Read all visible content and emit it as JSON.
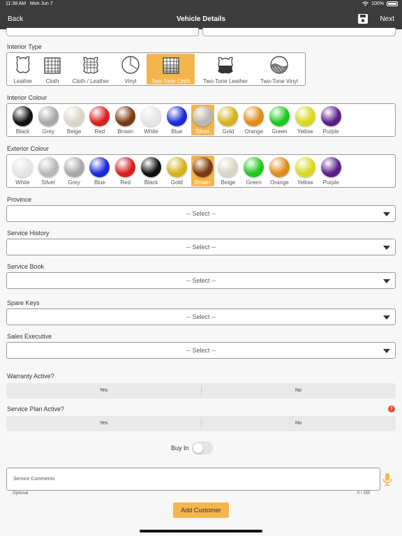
{
  "status": {
    "time": "11:38 AM",
    "date": "Mon Jun 7",
    "battery": "100%"
  },
  "nav": {
    "back": "Back",
    "title": "Vehicle Details",
    "next": "Next"
  },
  "interior_type": {
    "label": "Interior Type",
    "options": [
      "Leather",
      "Cloth",
      "Cloth / Leather",
      "Vinyl",
      "Two-Tone Cloth",
      "Two-Tone Leather",
      "Two-Tone Vinyl"
    ],
    "selected": "Two-Tone Cloth"
  },
  "interior_colour": {
    "label": "Interior Colour",
    "options": [
      {
        "name": "Black",
        "color": "#111111"
      },
      {
        "name": "Grey",
        "color": "#a8a8a8"
      },
      {
        "name": "Beige",
        "color": "#d8d6c8"
      },
      {
        "name": "Red",
        "color": "#d81f1f"
      },
      {
        "name": "Brown",
        "color": "#7a3a12"
      },
      {
        "name": "White",
        "color": "#e4e4e4"
      },
      {
        "name": "Blue",
        "color": "#1a2ad8"
      },
      {
        "name": "Silver",
        "color": "#b8b8b8"
      },
      {
        "name": "Gold",
        "color": "#d4b21a"
      },
      {
        "name": "Orange",
        "color": "#e08a1a"
      },
      {
        "name": "Green",
        "color": "#1ec81e"
      },
      {
        "name": "Yellow",
        "color": "#d8d820"
      },
      {
        "name": "Purple",
        "color": "#5a1f8a"
      }
    ],
    "selected": "Silver"
  },
  "exterior_colour": {
    "label": "Exterior Colour",
    "options": [
      {
        "name": "White",
        "color": "#e4e4e4"
      },
      {
        "name": "Silver",
        "color": "#b8b8b8"
      },
      {
        "name": "Grey",
        "color": "#a8a8a8"
      },
      {
        "name": "Blue",
        "color": "#1a2ad8"
      },
      {
        "name": "Red",
        "color": "#d81f1f"
      },
      {
        "name": "Black",
        "color": "#111111"
      },
      {
        "name": "Gold",
        "color": "#d4b21a"
      },
      {
        "name": "Brown",
        "color": "#7a3a12"
      },
      {
        "name": "Beige",
        "color": "#d8d6c8"
      },
      {
        "name": "Green",
        "color": "#1ec81e"
      },
      {
        "name": "Orange",
        "color": "#e08a1a"
      },
      {
        "name": "Yellow",
        "color": "#d8d820"
      },
      {
        "name": "Purple",
        "color": "#5a1f8a"
      }
    ],
    "selected": "Brown"
  },
  "selects": [
    {
      "label": "Province",
      "value": "-- Select --"
    },
    {
      "label": "Service History",
      "value": "-- Select --"
    },
    {
      "label": "Service Book",
      "value": "-- Select --"
    },
    {
      "label": "Spare Keys",
      "value": "-- Select --"
    },
    {
      "label": "Sales Executive",
      "value": "-- Select --"
    }
  ],
  "warranty": {
    "label": "Warranty Active?",
    "yes": "Yes",
    "no": "No"
  },
  "service_plan": {
    "label": "Service Plan Active?",
    "yes": "Yes",
    "no": "No",
    "alert": "!"
  },
  "buy_in": {
    "label": "Buy In",
    "on": false
  },
  "comments": {
    "placeholder": "Service Comments",
    "optional": "Optional",
    "count": "0 / 255"
  },
  "add_customer": "Add Customer",
  "accent": "#f5b54d"
}
